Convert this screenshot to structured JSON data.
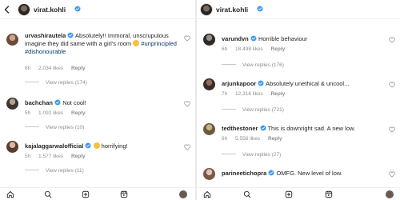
{
  "left": {
    "header": {
      "username": "virat.kohli"
    },
    "comments": [
      {
        "username": "urvashirautela",
        "text_a": "Absolutely!! Immoral, unscrupulous imagine they did same with a girl's room",
        "emoji_1": "grin-sweat",
        "hashtag_1": "#unprincipled",
        "hashtag_2": "#dishonourable",
        "time": "6h",
        "likes": "2,034 likes",
        "reply": "Reply",
        "view_replies": "View replies (174)"
      },
      {
        "username": "bachchan",
        "text": "Not cool!",
        "time": "5h",
        "likes": "1,092 likes",
        "reply": "Reply",
        "view_replies": "View replies (10)"
      },
      {
        "username": "kajalaggarwalofficial",
        "emoji_1": "screaming-face",
        "text": "horrifying!",
        "time": "5h",
        "likes": "1,577 likes",
        "reply": "Reply",
        "view_replies": "View replies (11)"
      }
    ]
  },
  "right": {
    "header": {
      "username": "virat.kohli"
    },
    "comments": [
      {
        "username": "varundvn",
        "text": "Horrible behaviour",
        "time": "6h",
        "likes": "18,498 likes",
        "reply": "Reply",
        "view_replies": "View replies (176)"
      },
      {
        "username": "arjunkapoor",
        "text": "Absolutely unethical & uncool...",
        "time": "7h",
        "likes": "12,316 likes",
        "reply": "Reply",
        "view_replies": "View replies (721)"
      },
      {
        "username": "tedthestoner",
        "text": "This is downright sad. A new low.",
        "time": "6h",
        "likes": "5,556 likes",
        "reply": "Reply",
        "view_replies": "View replies (27)"
      },
      {
        "username": "parineetichopra",
        "text": "OMFG. New level of low."
      }
    ]
  },
  "colors": {
    "verified": "#3897f0",
    "link": "#00376b",
    "muted": "#8e8e8e",
    "text": "#262626"
  },
  "icons": [
    "back-arrow-icon",
    "verified-badge-icon",
    "heart-icon",
    "home-icon",
    "search-icon",
    "add-icon",
    "reels-icon",
    "profile-icon"
  ]
}
